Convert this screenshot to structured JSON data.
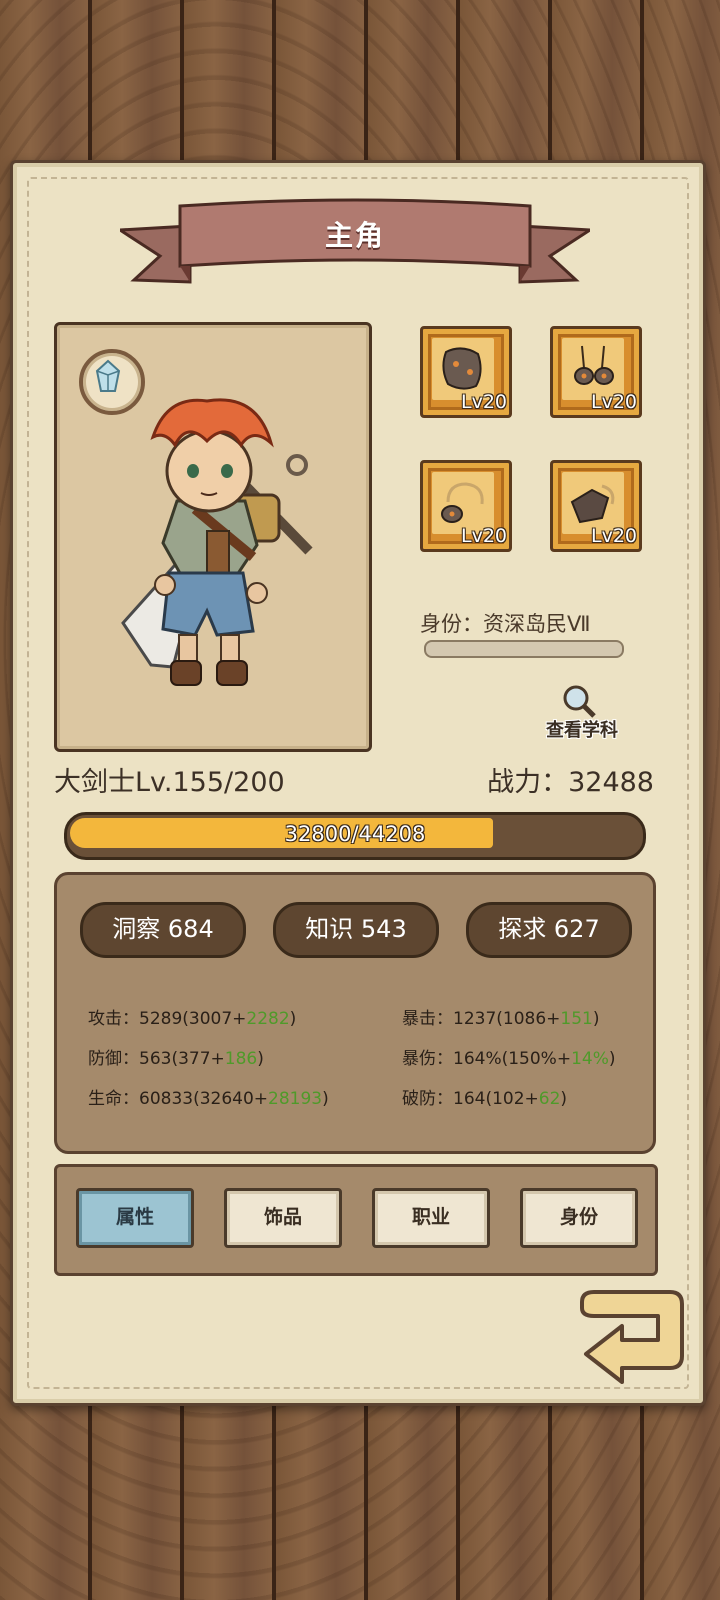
{
  "title": "主角",
  "equipment": [
    {
      "level": "Lv20",
      "icon": "rock-armor-icon"
    },
    {
      "level": "Lv20",
      "icon": "rock-pendant-icon"
    },
    {
      "level": "Lv20",
      "icon": "rock-ring-icon"
    },
    {
      "level": "Lv20",
      "icon": "rock-bracelet-icon"
    }
  ],
  "identity": "身份：资深岛民Ⅶ",
  "identity_progress": 0.0,
  "view_subject": "查看学科",
  "class_level": "大剑士Lv.155/200",
  "power": "战力：32488",
  "xp": {
    "text": "32800/44208",
    "current": 32800,
    "max": 44208
  },
  "attributes": [
    {
      "label": "洞察 684"
    },
    {
      "label": "知识 543"
    },
    {
      "label": "探求 627"
    }
  ],
  "stats_left": [
    {
      "label": "攻击：",
      "base": "5289(3007+",
      "bonus": "2282",
      "close": ")"
    },
    {
      "label": "防御：",
      "base": "563(377+",
      "bonus": "186",
      "close": ")"
    },
    {
      "label": "生命：",
      "base": "60833(32640+",
      "bonus": "28193",
      "close": ")"
    }
  ],
  "stats_right": [
    {
      "label": "暴击：",
      "base": "1237(1086+",
      "bonus": "151",
      "close": ")"
    },
    {
      "label": "暴伤：",
      "base": "164%(150%+",
      "bonus": "14%",
      "close": ")"
    },
    {
      "label": "破防：",
      "base": "164(102+",
      "bonus": "62",
      "close": ")"
    }
  ],
  "tabs": [
    {
      "label": "属性",
      "active": true
    },
    {
      "label": "饰品",
      "active": false
    },
    {
      "label": "职业",
      "active": false
    },
    {
      "label": "身份",
      "active": false
    }
  ],
  "colors": {
    "accent": "#f3b73c",
    "bonus": "#4f9a2a",
    "active_tab": "#9cc4d2"
  }
}
